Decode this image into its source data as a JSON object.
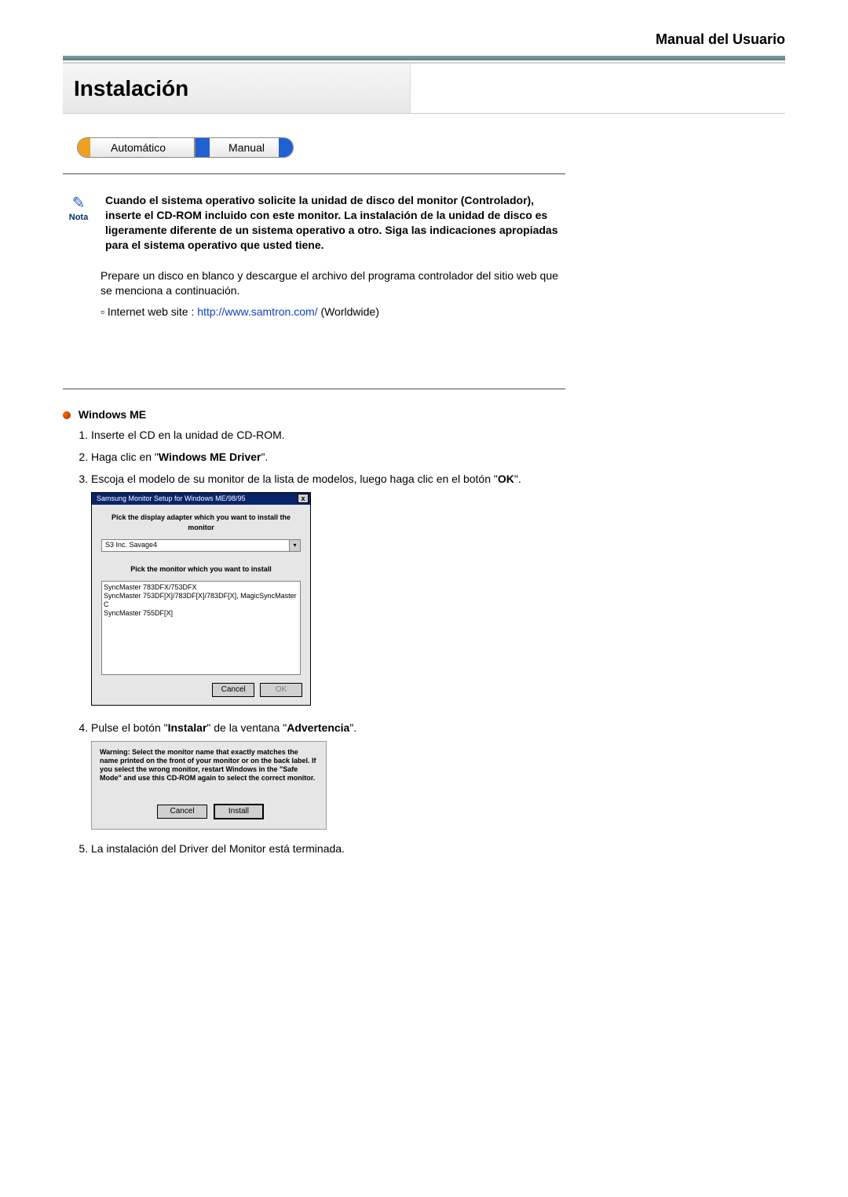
{
  "header": {
    "title": "Manual del Usuario"
  },
  "section_title": "Instalación",
  "tabs": {
    "left": "Automático",
    "right": "Manual"
  },
  "nota": {
    "label": "Nota",
    "text": "Cuando el sistema operativo solicite la unidad de disco del monitor (Controlador), inserte el CD-ROM incluido con este monitor. La instalación de la unidad de disco es ligeramente diferente de un sistema operativo a otro. Siga las indicaciones apropiadas para el sistema operativo que usted tiene."
  },
  "download_paragraph": "Prepare un disco en blanco y descargue el archivo del programa controlador del sitio web que se menciona a continuación.",
  "link": {
    "prefix": "Internet web site :",
    "url_text": "http://www.samtron.com/",
    "scope": "(Worldwide)"
  },
  "os_section": {
    "heading": "Windows ME"
  },
  "steps": {
    "s1": "Inserte el CD en la unidad de CD-ROM.",
    "s2_pre": "Haga clic en \"",
    "s2_bold": "Windows ME Driver",
    "s2_post": "\".",
    "s3_pre": "Escoja el modelo de su monitor de la lista de modelos, luego haga clic en el botón \"",
    "s3_bold": "OK",
    "s3_post": "\".",
    "s4_pre": "Pulse el botón \"",
    "s4_bold1": "Instalar",
    "s4_mid": "\" de la ventana \"",
    "s4_bold2": "Advertencia",
    "s4_post": "\".",
    "s5": "La instalación del Driver del Monitor está terminada."
  },
  "dialog1": {
    "title": "Samsung Monitor Setup for Windows  ME/98/95",
    "label_adapter": "Pick the display adapter which you want to install the monitor",
    "adapter_value": "S3 Inc. Savage4",
    "label_monitor": "Pick the monitor which you want to install",
    "models": {
      "m1": "SyncMaster 783DFX/753DFX",
      "m2": "SyncMaster 753DF[X]/783DF[X]/783DF[X], MagicSyncMaster C",
      "m3": "SyncMaster 755DF[X]"
    },
    "btn_cancel": "Cancel",
    "btn_ok": "OK"
  },
  "dialog2": {
    "warning": "Warning: Select the monitor name that exactly matches the name printed on the front of your monitor or on the back label. If you select the wrong monitor, restart Windows in the \"Safe Mode\" and use this CD-ROM again to select the correct monitor.",
    "btn_cancel": "Cancel",
    "btn_install": "Install"
  }
}
